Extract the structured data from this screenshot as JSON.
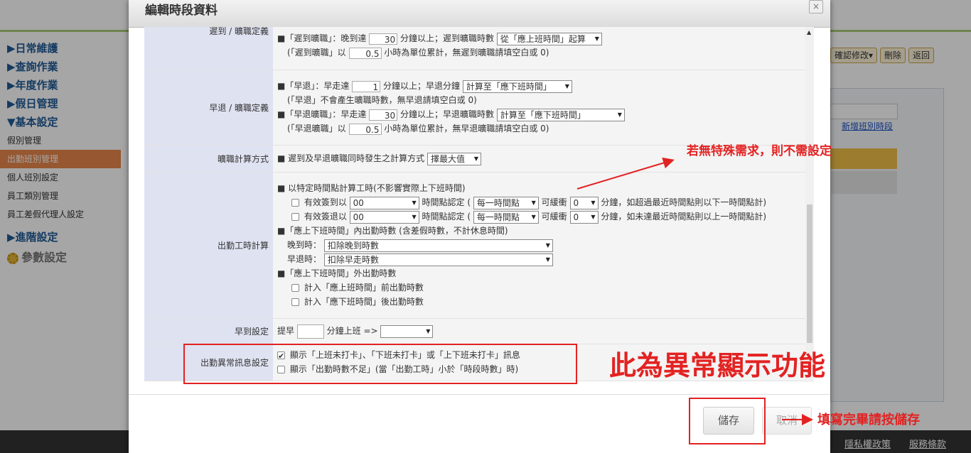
{
  "background": {
    "sidebar": {
      "daily": "▶日常維護",
      "query": "▶查詢作業",
      "annual": "▶年度作業",
      "holiday": "▶假日管理",
      "basic": "▼基本設定",
      "basic_items": [
        "假別管理",
        "出勤班別管理",
        "個人班別設定",
        "員工類別管理",
        "員工差假代理人設定"
      ],
      "advanced": "▶進階設定",
      "params": "參數設定"
    },
    "buttons": {
      "confirm": "確認修改▾",
      "delete": "刪除",
      "back": "返回"
    },
    "add_shift_link": "新增班別時段",
    "footer": {
      "privacy": "隱私權政策",
      "terms": "服務條款"
    }
  },
  "dialog": {
    "title": "編輯時段資料",
    "close": "×",
    "rows": {
      "late": {
        "label": "遲到 / 曠職定義",
        "line1_a": "■「遲到曠職」：晚到達",
        "line1_value": "30",
        "line1_b": "分鐘以上；遲到曠職時數",
        "line1_select": "從「應上班時間」起算",
        "line2_a": "(「遲到曠職」以",
        "line2_value": "0.5",
        "line2_b": "小時為單位累計，無遲到曠職請填空白或 0)"
      },
      "early": {
        "label": "早退 / 曠職定義",
        "line1_a": "■「早退」：早走達",
        "line1_value": "1",
        "line1_b": "分鐘以上；早退分鐘",
        "line1_select": "計算至「應下班時間」",
        "line2": "(「早退」不會產生曠職時數，無早退請填空白或 0)",
        "line3_a": "■「早退曠職」：早走達",
        "line3_value": "30",
        "line3_b": "分鐘以上；早退曠職時數",
        "line3_select": "計算至「應下班時間」",
        "line4_a": "(「早退曠職」以",
        "line4_value": "0.5",
        "line4_b": "小時為單位累計，無早退曠職請填空白或 0)"
      },
      "calc": {
        "label": "曠職計算方式",
        "text": "■ 遲到及早退曠職同時發生之計算方式",
        "select": "擇最大值"
      },
      "work": {
        "label": "出勤工時計算",
        "l1": "■ 以特定時間點計算工時(不影響實際上下班時間)",
        "in_label": "有效簽到以",
        "in_select": "00",
        "in_mid": "時間點認定 (",
        "in_select2": "每一時間點",
        "in_buffer": "可緩衝",
        "in_select3": "0",
        "in_tail": "分鐘，如超過最近時間點則以下一時間點計)",
        "out_label": "有效簽退以",
        "out_select": "00",
        "out_mid": "時間點認定 (",
        "out_select2": "每一時間點",
        "out_buffer": "可緩衝",
        "out_select3": "0",
        "out_tail": "分鐘，如未達最近時間點則以上一時間點計)",
        "l2": "■「應上下班時間」內出勤時數 (含差假時數，不計休息時間)",
        "late_label": "晚到時：",
        "late_select": "扣除晚到時數",
        "early_label": "早退時：",
        "early_select": "扣除早走時數",
        "l3": "■「應上下班時間」外出勤時數",
        "before": "計入「應上班時間」前出勤時數",
        "after": "計入「應下班時間」後出勤時數"
      },
      "earlyin": {
        "label": "早到設定",
        "a": "提早",
        "b": "分鐘上班 =>"
      },
      "msg": {
        "label": "出勤異常訊息設定",
        "opt1": "顯示「上班未打卡」、「下班未打卡」或「上下班未打卡」訊息",
        "opt2": "顯示「出勤時數不足」(當「出勤工時」小於「時段時數」時)"
      }
    },
    "save": "儲存",
    "cancel": "取消"
  },
  "annotations": {
    "no_need": "若無特殊需求，則不需設定",
    "abnormal": "此為異常顯示功能",
    "save_hint": "填寫完畢請按儲存"
  },
  "colors": {
    "annotation": "#e32222",
    "active_menu": "#e8864a",
    "label_bg": "#dfe2f1"
  }
}
